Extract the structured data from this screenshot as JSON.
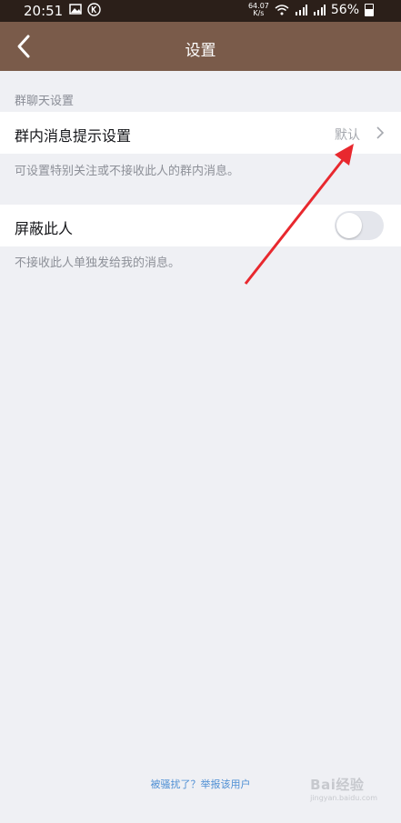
{
  "status_bar": {
    "time": "20:51",
    "net_speed_value": "64.07",
    "net_speed_unit": "K/s",
    "battery": "56%"
  },
  "header": {
    "title": "设置"
  },
  "section": {
    "title": "群聊天设置"
  },
  "group_notify": {
    "label": "群内消息提示设置",
    "value": "默认",
    "hint": "可设置特别关注或不接收此人的群内消息。"
  },
  "block": {
    "label": "屏蔽此人",
    "hint": "不接收此人单独发给我的消息。",
    "enabled": false
  },
  "footer": {
    "report_link": "被骚扰了？举报该用户"
  },
  "watermark": {
    "text": "Bai经验",
    "url": "jingyan.baidu.com"
  },
  "colors": {
    "header_bg": "#7a5b4a",
    "status_bg": "#2b1f19",
    "page_bg": "#eff0f4",
    "link": "#4e8fd4",
    "annotation_arrow": "#e8282e"
  }
}
